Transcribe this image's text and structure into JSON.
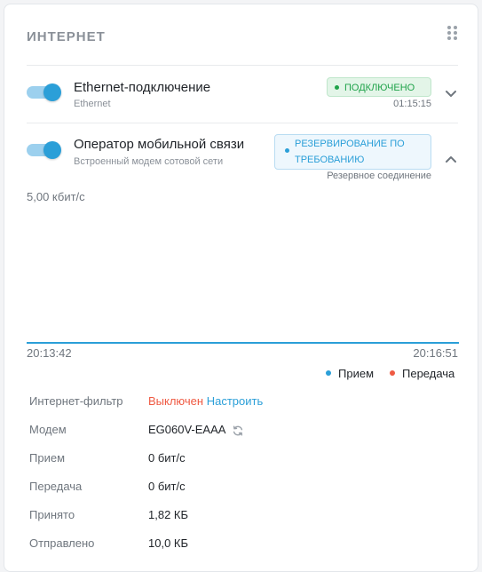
{
  "widget": {
    "title": "ИНТЕРНЕТ"
  },
  "connections": [
    {
      "name": "Ethernet-подключение",
      "type": "Ethernet",
      "enabled": true,
      "status_label": "ПОДКЛЮЧЕНО",
      "status_color": "#1fa34a",
      "uptime": "01:15:15",
      "expanded": false
    },
    {
      "name": "Оператор мобильной связи",
      "type": "Встроенный модем сотовой сети",
      "enabled": true,
      "status_label_line1": "РЕЗЕРВИРОВАНИЕ ПО",
      "status_label_line2": "ТРЕБОВАНИЮ",
      "status_color": "#2b9fd8",
      "role": "Резервное соединение",
      "expanded": true
    }
  ],
  "chart_data": {
    "type": "line",
    "y_max_label": "5,00 кбит/с",
    "x_start": "20:13:42",
    "x_end": "20:16:51",
    "series": [
      {
        "name": "Прием",
        "color": "#2b9fd8",
        "values": [
          0,
          0
        ]
      },
      {
        "name": "Передача",
        "color": "#ef5a43",
        "values": [
          0,
          0
        ]
      }
    ]
  },
  "details": {
    "filter_label": "Интернет-фильтр",
    "filter_value": "Выключен",
    "filter_action": "Настроить",
    "modem_label": "Модем",
    "modem_value": "EG060V-EAAA",
    "rx_label": "Прием",
    "rx_value": "0 бит/с",
    "tx_label": "Передача",
    "tx_value": "0 бит/с",
    "received_label": "Принято",
    "received_value": "1,82 КБ",
    "sent_label": "Отправлено",
    "sent_value": "10,0 КБ"
  },
  "colors": {
    "accent": "#2b9fd8",
    "success": "#1fa34a",
    "danger": "#ef5a43"
  }
}
